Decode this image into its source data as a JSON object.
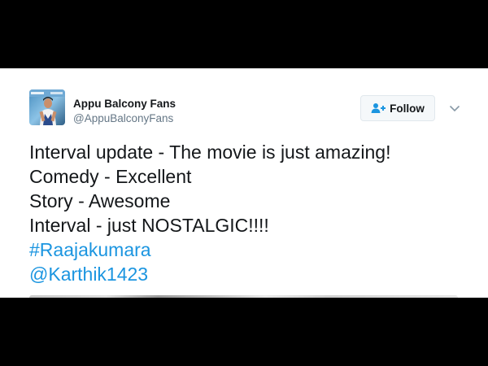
{
  "tweet": {
    "display_name": "Appu Balcony Fans",
    "handle": "@AppuBalconyFans",
    "follow_label": "Follow",
    "lines": [
      "Interval update - The movie is just amazing!",
      "Comedy - Excellent",
      "Story - Awesome",
      "Interval - just NOSTALGIC!!!!"
    ],
    "hashtag": "#Raajakumara",
    "mention": "@Karthik1423"
  },
  "icons": {
    "follow": "add-user-icon",
    "caret": "chevron-down-icon",
    "avatar": "profile-avatar-image"
  },
  "colors": {
    "background": "#000000",
    "card": "#ffffff",
    "link": "#1b95e0",
    "text": "#14171a",
    "muted": "#657786"
  }
}
